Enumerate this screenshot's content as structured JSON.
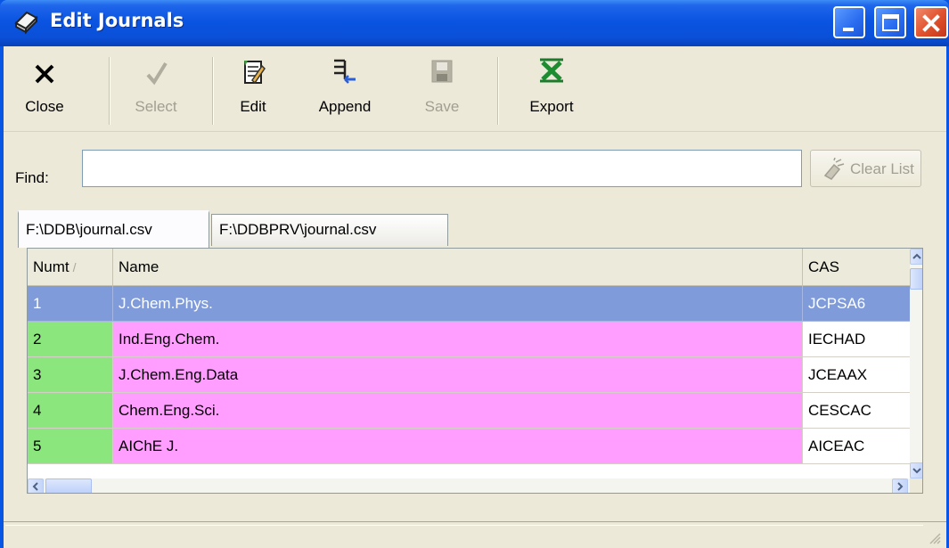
{
  "window": {
    "title": "Edit Journals"
  },
  "toolbar": {
    "close": "Close",
    "select": "Select",
    "edit": "Edit",
    "append": "Append",
    "save": "Save",
    "export": "Export"
  },
  "find": {
    "label": "Find:",
    "value": ""
  },
  "clear_list": "Clear List",
  "tabs": [
    "F:\\DDB\\journal.csv",
    "F:\\DDBPRV\\journal.csv"
  ],
  "grid": {
    "columns": [
      "Numt",
      "Name",
      "CAS"
    ],
    "sort_indicator": "/",
    "rows": [
      {
        "num": "1",
        "name": "J.Chem.Phys.",
        "cas": "JCPSA6"
      },
      {
        "num": "2",
        "name": "Ind.Eng.Chem.",
        "cas": "IECHAD"
      },
      {
        "num": "3",
        "name": "J.Chem.Eng.Data",
        "cas": "JCEAAX"
      },
      {
        "num": "4",
        "name": "Chem.Eng.Sci.",
        "cas": "CESCAC"
      },
      {
        "num": "5",
        "name": "AIChE J.",
        "cas": "AICEAC"
      }
    ]
  },
  "colors": {
    "selection": "#7f9bd9",
    "number_cell": "#8ce67e",
    "name_cell": "#ff9eff",
    "titlebar": "#0a54e2"
  },
  "icons": {
    "title": "journal-icon",
    "close": "x-icon",
    "select": "checkmark-icon",
    "edit": "edit-icon",
    "append": "append-icon",
    "save": "floppy-icon",
    "export": "excel-icon",
    "clear": "eraser-icon"
  }
}
